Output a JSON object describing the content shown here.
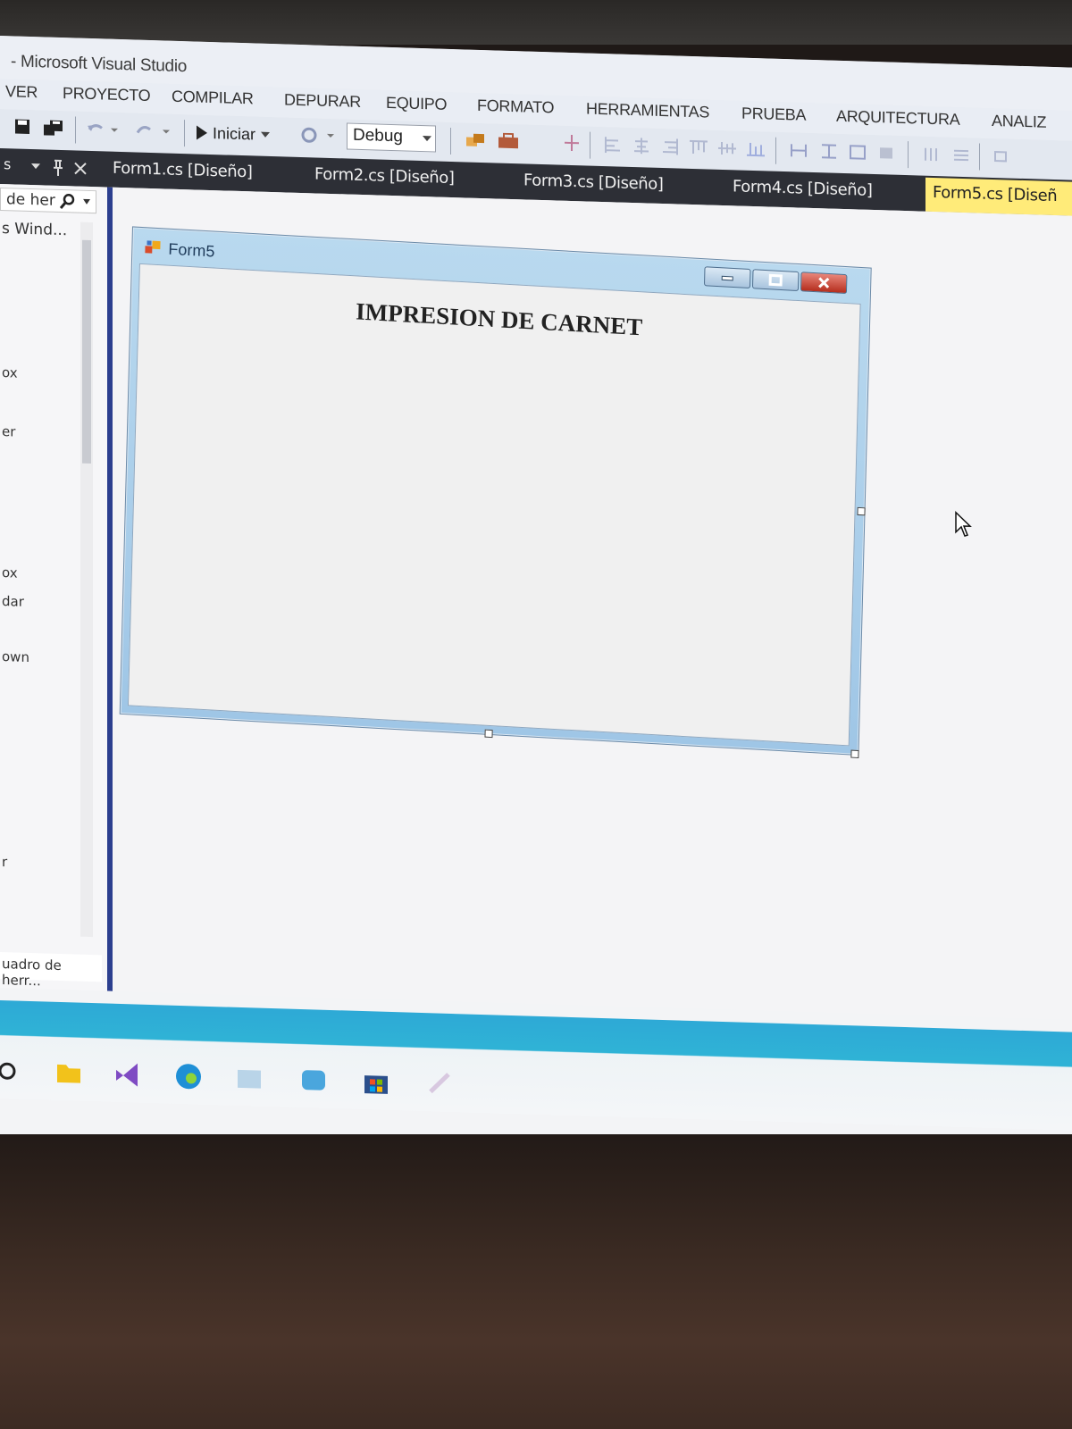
{
  "window": {
    "title": "- Microsoft Visual Studio"
  },
  "menu": [
    "VER",
    "PROYECTO",
    "COMPILAR",
    "DEPURAR",
    "EQUIPO",
    "FORMATO",
    "HERRAMIENTAS",
    "PRUEBA",
    "ARQUITECTURA",
    "ANALIZ"
  ],
  "toolbar": {
    "start_label": "Iniciar",
    "configuration": "Debug"
  },
  "tabs": {
    "toolbox_header": "s",
    "documents": [
      "Form1.cs [Diseño]",
      "Form2.cs [Diseño]",
      "Form3.cs [Diseño]",
      "Form4.cs [Diseño]"
    ],
    "active": "Form5.cs [Diseñ"
  },
  "toolbox": {
    "search": "de her",
    "group": "s Wind...",
    "entries": [
      "ox",
      "er",
      "ox",
      "dar",
      "own",
      "r"
    ],
    "footer": "uadro de herr..."
  },
  "form": {
    "title": "Form5",
    "heading": "IMPRESION DE CARNET"
  },
  "colors": {
    "active_tab": "#ffeb79",
    "close_button": "#c0392b",
    "taskbar": "#2fb3d6"
  },
  "taskbar_icons": [
    "search-icon",
    "file-explorer-icon",
    "visual-studio-icon",
    "edge-icon",
    "app-icon",
    "mail-icon",
    "store-icon",
    "paint-icon"
  ]
}
